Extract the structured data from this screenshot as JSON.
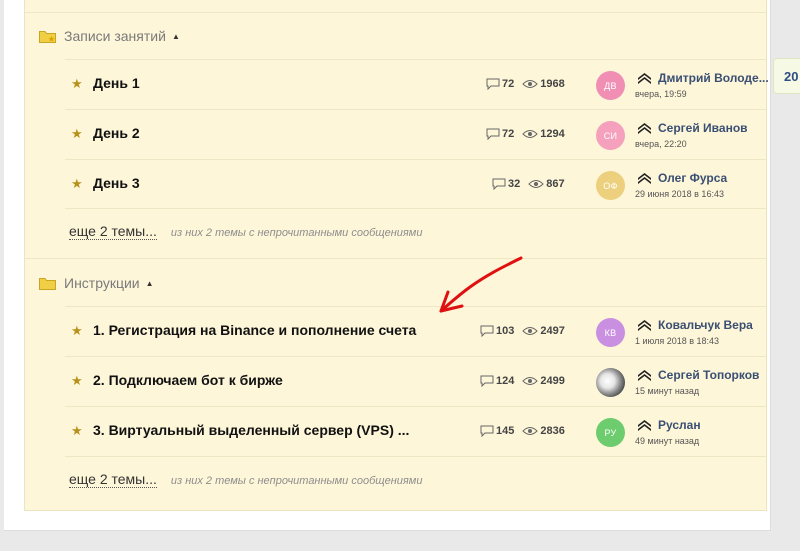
{
  "categories": [
    {
      "label": "Записи занятий",
      "more_link": "еще 2 темы...",
      "more_note": "из них 2 темы с непрочитанными сообщениями",
      "topics": [
        {
          "title": "День 1",
          "replies": "72",
          "views": "1968",
          "avatar_initials": "ДВ",
          "avatar_color": "#f08fb3",
          "author": "Дмитрий Володе...",
          "time": "вчера, 19:59"
        },
        {
          "title": "День 2",
          "replies": "72",
          "views": "1294",
          "avatar_initials": "СИ",
          "avatar_color": "#f5a0bd",
          "author": "Сергей Иванов",
          "time": "вчера, 22:20"
        },
        {
          "title": "День 3",
          "replies": "32",
          "views": "867",
          "avatar_initials": "ОФ",
          "avatar_color": "#ecd07e",
          "author": "Олег Фурса",
          "time": "29 июня 2018 в 16:43"
        }
      ]
    },
    {
      "label": "Инструкции",
      "more_link": "еще 2 темы...",
      "more_note": "из них 2 темы с непрочитанными сообщениями",
      "topics": [
        {
          "title": "1. Регистрация на Binance и пополнение счета",
          "replies": "103",
          "views": "2497",
          "avatar_initials": "КВ",
          "avatar_color": "#c98fe0",
          "author": "Ковальчук Вера",
          "time": "1 июля 2018 в 18:43"
        },
        {
          "title": "2. Подключаем бот к бирже",
          "replies": "124",
          "views": "2499",
          "avatar_initials": "",
          "avatar_color": "#9a9a9a",
          "author": "Сергей Топорков",
          "time": "15 минут назад"
        },
        {
          "title": "3. Виртуальный выделенный сервер (VPS) ...",
          "replies": "145",
          "views": "2836",
          "avatar_initials": "РУ",
          "avatar_color": "#6dcc6d",
          "author": "Руслан",
          "time": "49 минут назад"
        }
      ]
    }
  ],
  "side_badge": "20",
  "colors": {
    "star": "#b8911c",
    "folder": "#f1cf45",
    "annotation_arrow": "#e01010",
    "author_link": "#3a4f72"
  },
  "icons": {
    "category": "folder-icon",
    "pinned": "star-icon",
    "replies": "comment-icon",
    "views": "eye-icon",
    "rank": "chevrons-up-icon",
    "toggle": "caret-up-icon"
  }
}
